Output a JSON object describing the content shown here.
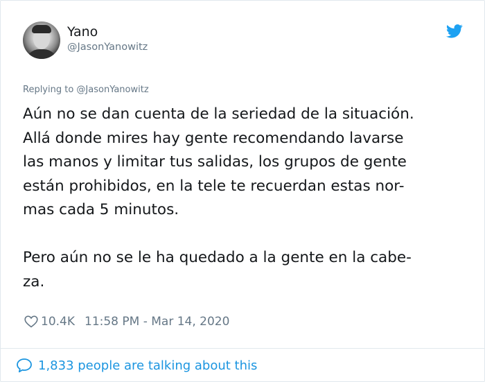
{
  "user": {
    "name": "Yano",
    "handle": "@JasonYanowitz"
  },
  "reply_context": "Replying to @JasonYanowitz",
  "tweet": {
    "text": "Aún no se dan cuenta de la seriedad de la situación.\nAllá donde mires hay gente recomendando lavarse\nlas manos y limitar tus salidas, los grupos de gente\nestán prohibidos, en la tele te recuerdan estas nor-\nmas cada 5 minutos.\n\nPero aún no se le ha quedado a la gente en la cabe-\nza.",
    "likes": "10.4K",
    "timestamp": "11:58 PM - Mar 14, 2020"
  },
  "footer": {
    "talking": "1,833 people are talking about this"
  },
  "icons": {
    "brand": "twitter-bird-icon",
    "like": "heart-icon",
    "talking": "speech-bubble-icon"
  },
  "colors": {
    "twitter_blue": "#1da1f2",
    "link_blue": "#1b95e0",
    "secondary_text": "#657786",
    "primary_text": "#14171a",
    "border": "#e1e8ed"
  }
}
